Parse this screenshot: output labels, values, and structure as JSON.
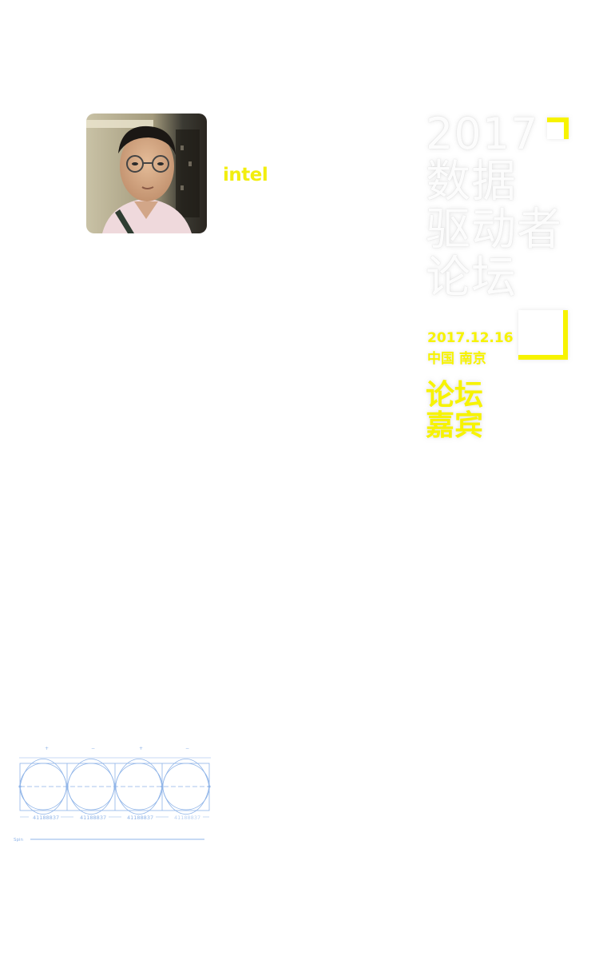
{
  "speaker": {
    "company": "intel"
  },
  "event": {
    "year": "2017",
    "title_lines": [
      "数据",
      "驱动者",
      "论坛"
    ],
    "date": "2017.12.16",
    "place": "中国 南京",
    "section_lines": [
      "论坛",
      "嘉宾"
    ]
  },
  "diagram": {
    "signs": [
      "+",
      "−",
      "+",
      "−"
    ],
    "cell_labels": [
      "41188837",
      "41188837",
      "41188837",
      "41188837"
    ],
    "spin_label": "Spin"
  },
  "colors": {
    "accent_yellow": "#f7f300",
    "diagram_blue": "#8fb4e8"
  }
}
